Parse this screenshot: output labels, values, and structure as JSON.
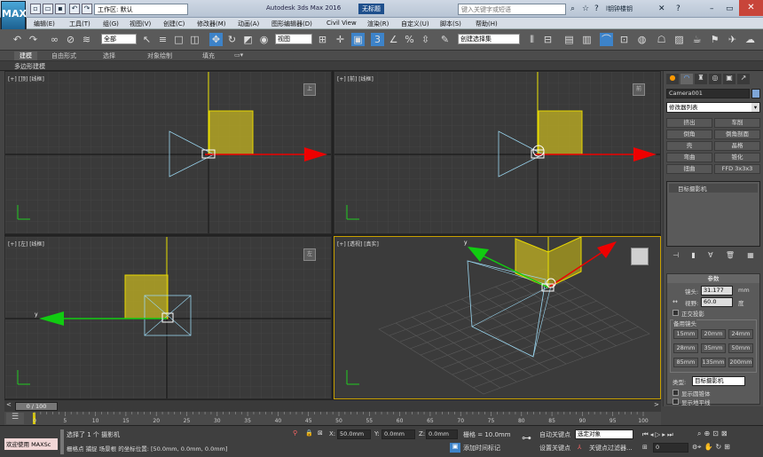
{
  "app": {
    "logo": "MAX",
    "title": "Autodesk 3ds Max 2016",
    "file": "无标题",
    "workspace": "工作区: 默认",
    "search_placeholder": "键入关键字或短语",
    "user": "l钥钟楼钥"
  },
  "menu": [
    "编辑(E)",
    "工具(T)",
    "组(G)",
    "视图(V)",
    "创建(C)",
    "修改器(M)",
    "动画(A)",
    "图形编辑器(D)",
    "Civil View",
    "渲染(R)",
    "自定义(U)",
    "脚本(S)",
    "帮助(H)"
  ],
  "toolbar": {
    "filter": "全部",
    "view_select": "视图",
    "selset": "创建选择集"
  },
  "ribbon": {
    "tabs": [
      "建模",
      "自由形式",
      "选择",
      "对象绘制",
      "填充"
    ],
    "sub": "多边形建模"
  },
  "viewports": {
    "top": "[+] [顶] [线框]",
    "front": "[+] [前] [线框]",
    "left": "[+] [左] [线框]",
    "persp": "[+] [透视] [真实]"
  },
  "cmd": {
    "object_name": "Camera001",
    "modifier_list": "修改器列表",
    "buttons": [
      [
        "挤出",
        "车削"
      ],
      [
        "倒角",
        "倒角剖面"
      ],
      [
        "壳",
        "晶格"
      ],
      [
        "弯曲",
        "锥化"
      ],
      [
        "扭曲",
        "FFD 3x3x3"
      ]
    ],
    "stack_item": "目标摄影机",
    "rollout_title": "参数",
    "lens_label": "镜头:",
    "lens_value": "31.177",
    "lens_unit": "mm",
    "fov_label": "视野:",
    "fov_value": "60.0",
    "fov_unit": "度",
    "ortho": "正交投影",
    "stock_title": "备用镜头",
    "stock": [
      "15mm",
      "20mm",
      "24mm",
      "28mm",
      "35mm",
      "50mm",
      "85mm",
      "135mm",
      "200mm"
    ],
    "type_label": "类型:",
    "type_value": "目标摄影机",
    "show_cone": "显示圆锥体",
    "show_horizon": "显示地平线"
  },
  "timeline": {
    "frame": "0 / 100",
    "ticks": [
      "0",
      "5",
      "10",
      "15",
      "20",
      "25",
      "30",
      "35",
      "40",
      "45",
      "50",
      "55",
      "60",
      "65",
      "70",
      "75",
      "80",
      "85",
      "90",
      "95",
      "100"
    ]
  },
  "status": {
    "welcome": "欢迎使用 MAXSc",
    "selected": "选择了 1 个 摄影机",
    "prompt": "栅格点 捕捉 场景根 的坐标位置: [50.0mm, 0.0mm, 0.0mm]",
    "x_label": "X:",
    "x": "50.0mm",
    "y_label": "Y:",
    "y": "0.0mm",
    "z_label": "Z:",
    "z": "0.0mm",
    "grid": "栅格 = 10.0mm",
    "add_tag": "添加时间标记",
    "autokey": "自动关键点",
    "setkey": "设置关键点",
    "keymode": "选定对象",
    "keyfilter": "关键点过滤器...",
    "frame_field": "0"
  }
}
